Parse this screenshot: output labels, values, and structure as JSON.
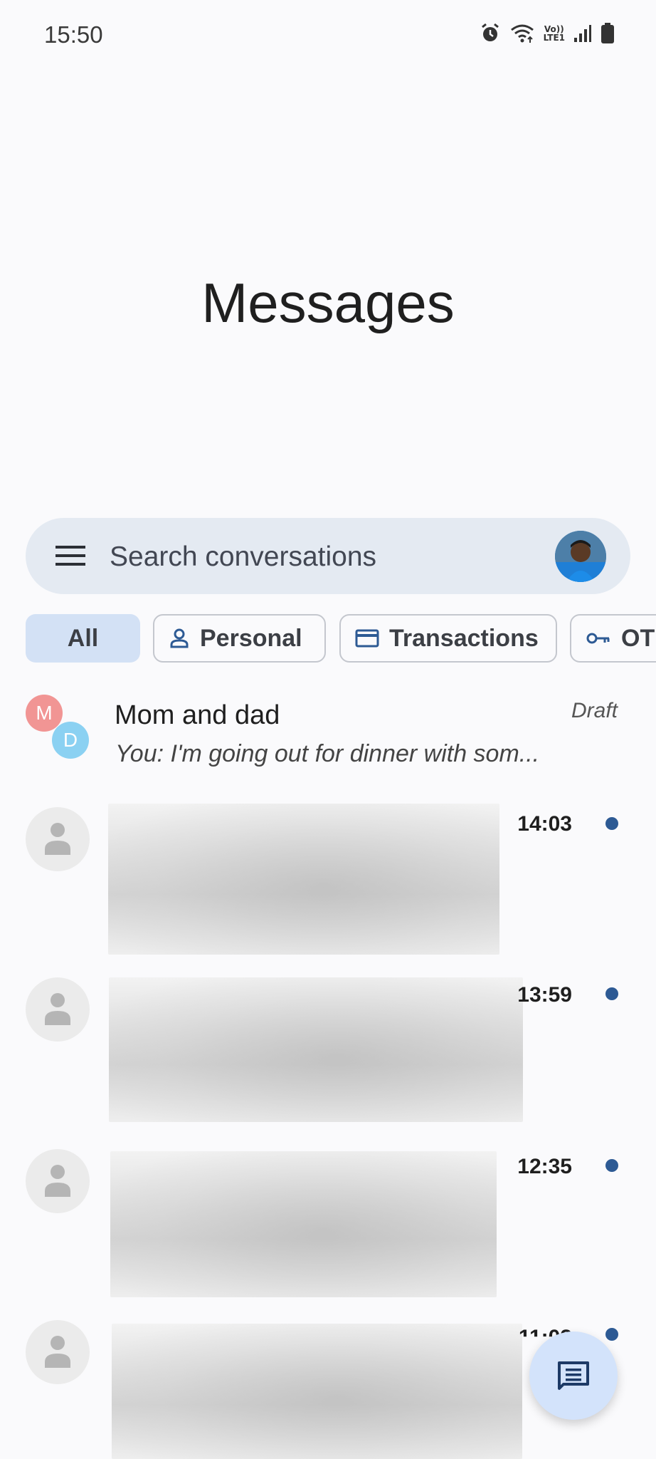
{
  "status_bar": {
    "time": "15:50",
    "network_label_top": "Vo))",
    "network_label_bottom": "LTE1",
    "icons": [
      "alarm-icon",
      "wifi-icon",
      "volte-icon",
      "signal-icon",
      "battery-icon"
    ]
  },
  "header": {
    "title": "Messages"
  },
  "search": {
    "placeholder": "Search conversations"
  },
  "filters": [
    {
      "label": "All",
      "selected": true
    },
    {
      "label": "Personal",
      "icon": "person-icon"
    },
    {
      "label": "Transactions",
      "icon": "card-icon"
    },
    {
      "label": "OTP",
      "icon": "key-icon"
    }
  ],
  "conversations": [
    {
      "name": "Mom and dad",
      "snippet": "You: I'm going out for dinner with som...",
      "status": "Draft",
      "avatars": [
        "M",
        "D"
      ]
    },
    {
      "time": "14:03",
      "unread": true
    },
    {
      "time": "13:59",
      "unread": true
    },
    {
      "time": "12:35",
      "unread": true
    },
    {
      "time": "11:02",
      "unread": true
    }
  ],
  "colors": {
    "accent": "#2d5a94",
    "chip_selected": "#d3e1f5",
    "search_bg": "#e4eaf2",
    "fab_bg": "#d3e3fb"
  }
}
